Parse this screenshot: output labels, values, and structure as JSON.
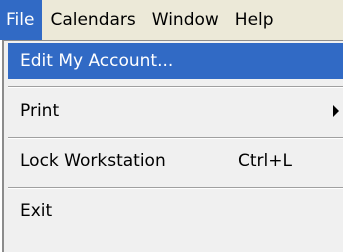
{
  "menubar": {
    "items": [
      {
        "label": "File"
      },
      {
        "label": "Calendars"
      },
      {
        "label": "Window"
      },
      {
        "label": "Help"
      }
    ]
  },
  "file_menu": {
    "edit_account": "Edit My Account...",
    "print": "Print",
    "lock_workstation": "Lock Workstation",
    "lock_shortcut": "Ctrl+L",
    "exit": "Exit"
  },
  "colors": {
    "highlight": "#316ac5",
    "menu_background": "#f0f0f0",
    "menubar_background": "#ece9d8"
  }
}
